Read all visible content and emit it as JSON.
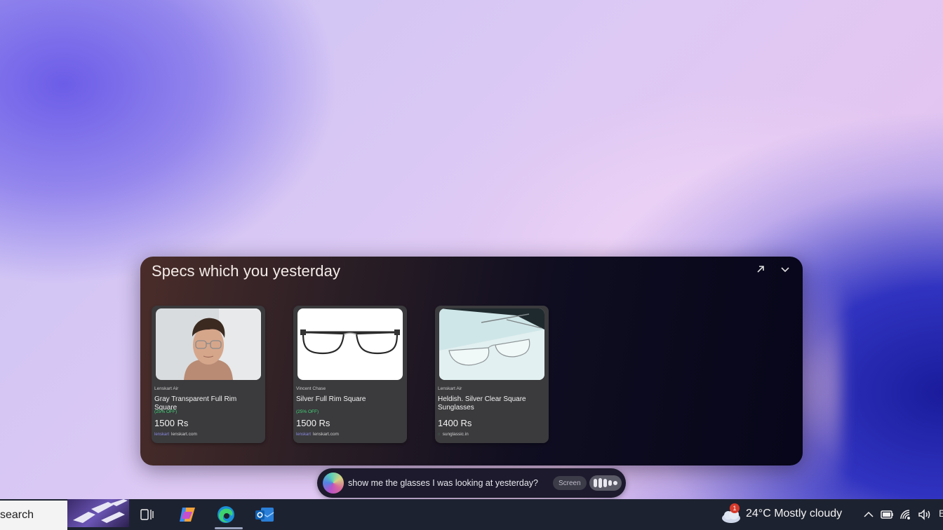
{
  "panel": {
    "title": "Specs which you yesterday",
    "actions": {
      "expand_icon": "arrow-up-right-icon",
      "collapse_icon": "chevron-down-icon"
    },
    "products": [
      {
        "brand": "Lenskart Air",
        "name": "Gray Transparent Full Rim Square",
        "discount": "(25% OFF)",
        "price": "1500 Rs",
        "source_logo": "lenskart",
        "source": "lenskart.com"
      },
      {
        "brand": "Vincent Chase",
        "name": "Silver Full Rim Square",
        "discount": "(25% OFF)",
        "price": "1500 Rs",
        "source_logo": "lenskart",
        "source": "lenskart.com"
      },
      {
        "brand": "Lenskart Air",
        "name": "Heldish. Silver Clear Square Sunglasses",
        "discount": "",
        "price": "1400 Rs",
        "source_logo": "",
        "source": "sunglassic.in"
      }
    ]
  },
  "query_bar": {
    "text": "show me the glasses I was looking at yesterday?",
    "screen_chip": "Screen",
    "voice_icon": "waveform-icon"
  },
  "taskbar": {
    "search_text": "search",
    "apps": [
      "task-view-icon",
      "copilot-icon",
      "edge-icon",
      "outlook-icon"
    ],
    "weather": {
      "badge": "1",
      "text": "24°C  Mostly cloudy",
      "icon": "cloud-moon-icon"
    },
    "tray_icons": [
      "chevron-up-icon",
      "battery-icon",
      "wifi-icon",
      "volume-icon"
    ],
    "tray_cut": "E"
  }
}
